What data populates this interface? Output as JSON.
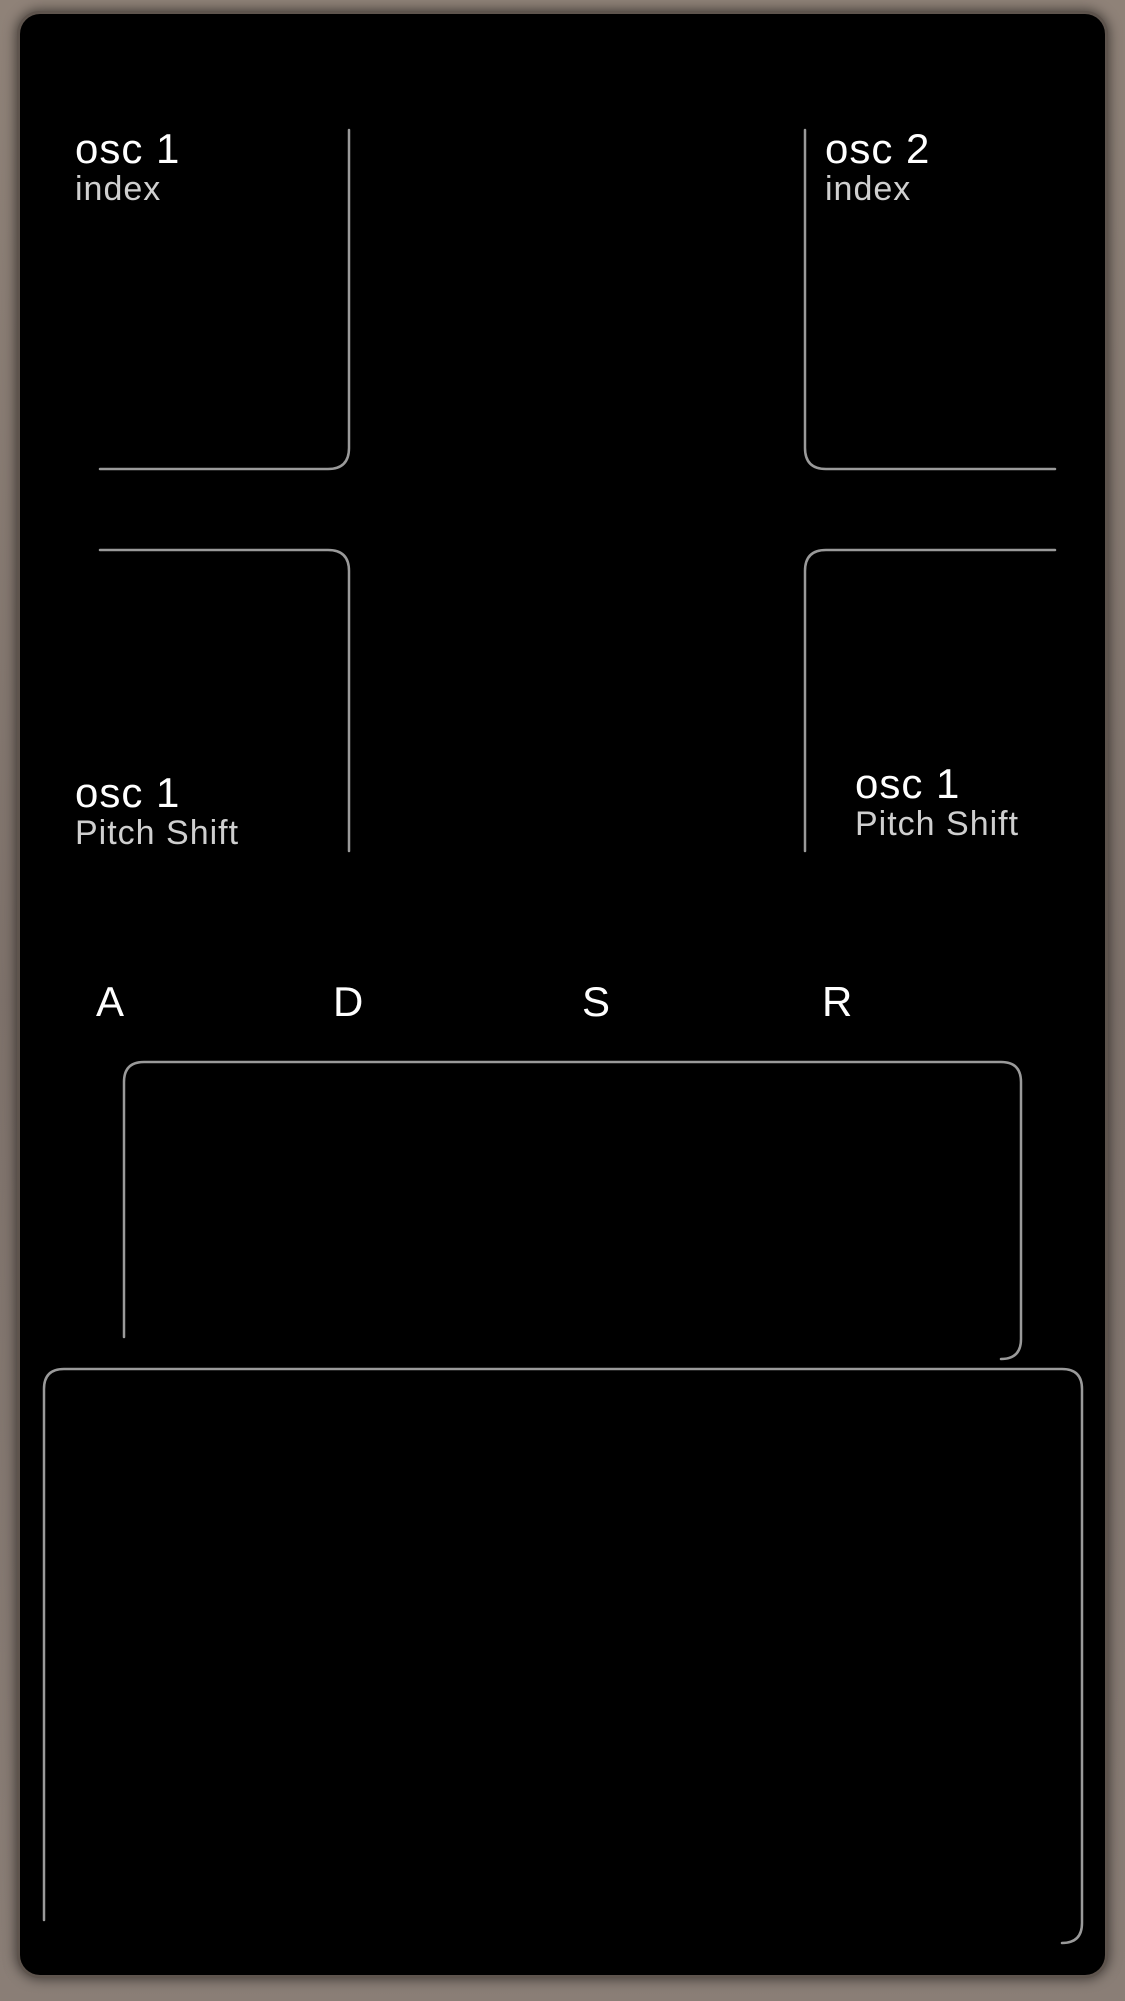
{
  "controls": {
    "top_left": {
      "title": "osc 1",
      "subtitle": "index"
    },
    "top_right": {
      "title": "osc 2",
      "subtitle": "index"
    },
    "bottom_left": {
      "title": "osc 1",
      "subtitle": "Pitch Shift"
    },
    "bottom_right": {
      "title": "osc 1",
      "subtitle": "Pitch Shift"
    }
  },
  "adsr": {
    "attack": "A",
    "decay": "D",
    "sustain": "S",
    "release": "R"
  },
  "colors": {
    "panel": "#000000",
    "frame_line": "#9a9a9a",
    "label_primary": "#ffffff",
    "label_secondary": "#cfcfcf"
  }
}
